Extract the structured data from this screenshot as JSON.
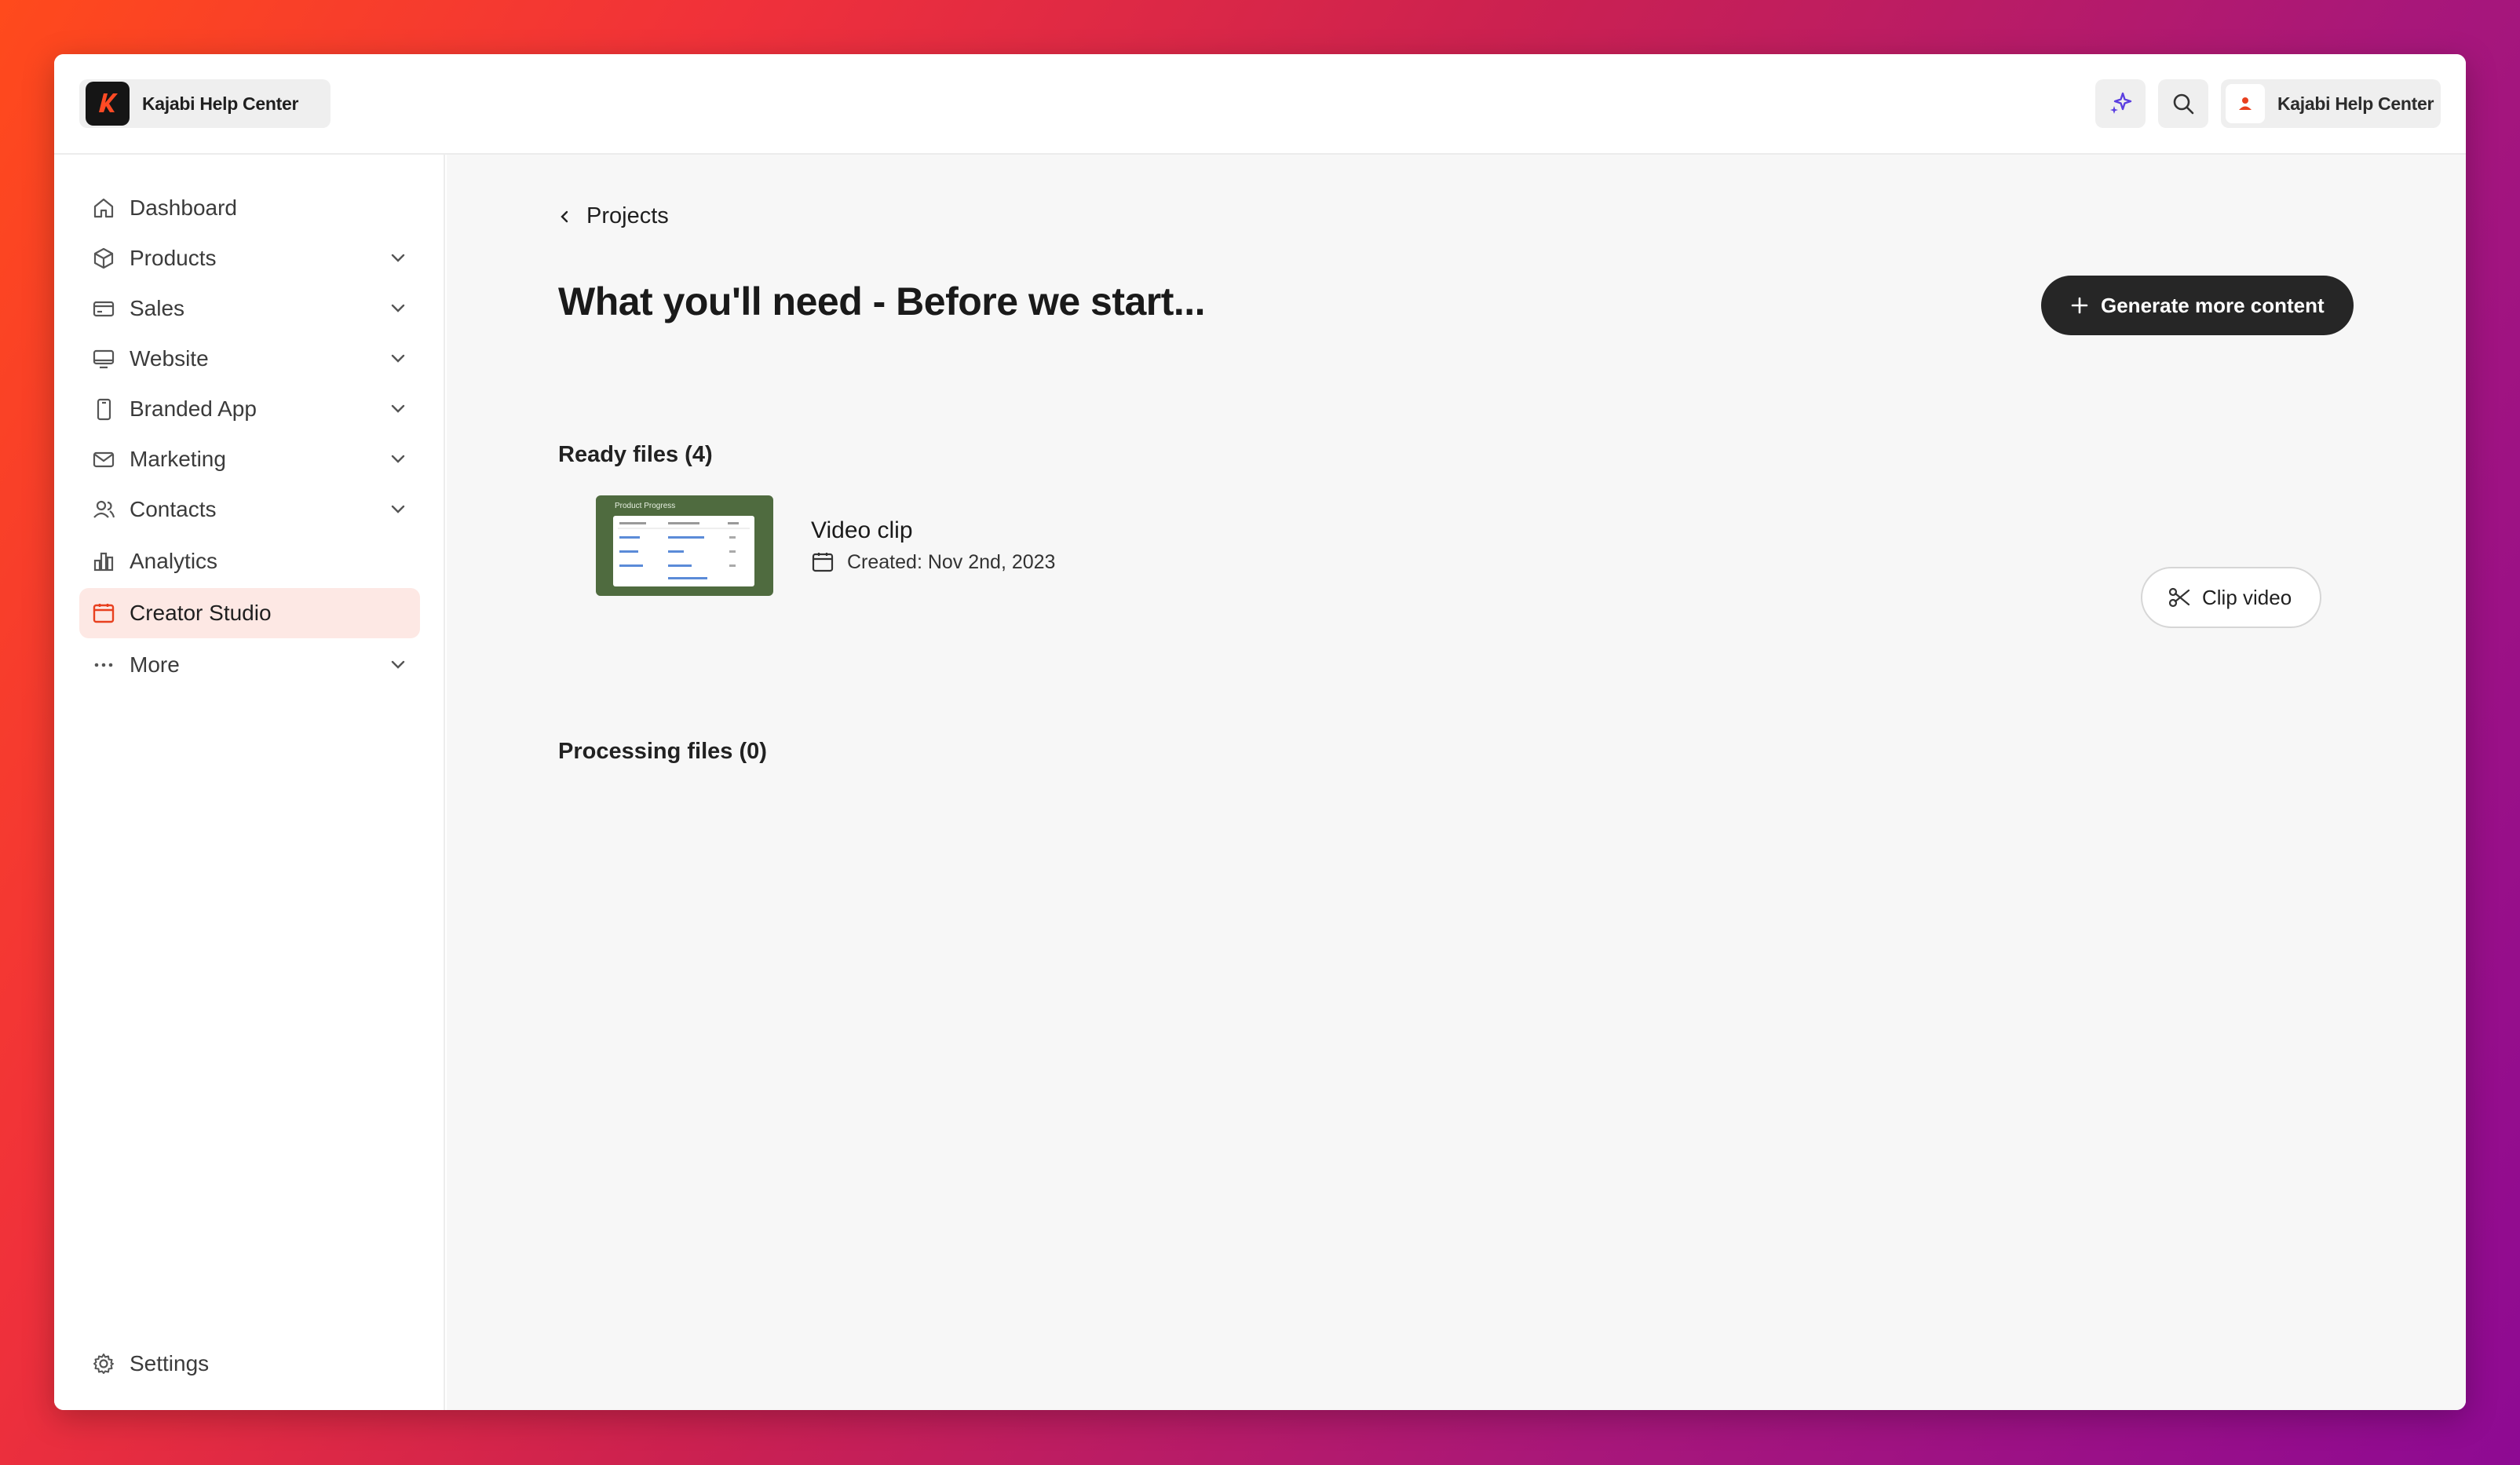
{
  "header": {
    "brand_name": "Kajabi Help Center",
    "account_name": "Kajabi Help Center"
  },
  "sidebar": {
    "items": [
      {
        "label": "Dashboard",
        "icon": "home-icon"
      },
      {
        "label": "Products",
        "icon": "box-icon"
      },
      {
        "label": "Sales",
        "icon": "credit-card-icon"
      },
      {
        "label": "Website",
        "icon": "monitor-icon"
      },
      {
        "label": "Branded App",
        "icon": "phone-icon"
      },
      {
        "label": "Marketing",
        "icon": "mail-icon"
      },
      {
        "label": "Contacts",
        "icon": "users-icon"
      },
      {
        "label": "Analytics",
        "icon": "bar-chart-icon"
      },
      {
        "label": "Creator Studio",
        "icon": "calendar-icon"
      },
      {
        "label": "More",
        "icon": "more-dots-icon"
      }
    ],
    "settings_label": "Settings"
  },
  "main": {
    "breadcrumb": "Projects",
    "title": "What you'll need - Before we start...",
    "generate_button": "Generate more content",
    "ready_heading": "Ready files (4)",
    "processing_heading": "Processing files (0)",
    "files": [
      {
        "thumbnail_title": "Product Progress",
        "name": "Video clip",
        "created": "Created: Nov 2nd, 2023",
        "action": "Clip video"
      }
    ]
  },
  "colors": {
    "accent": "#e8401f",
    "active_nav_bg": "#fde8e4",
    "dark_button": "#262626",
    "thumbnail_bg": "#4f6b3f"
  }
}
